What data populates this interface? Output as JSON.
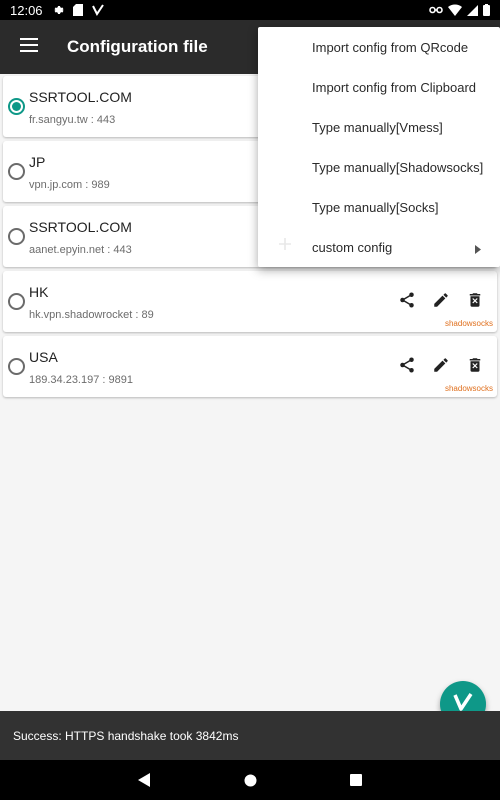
{
  "status_bar": {
    "time": "12:06"
  },
  "app_bar": {
    "title": "Configuration file"
  },
  "servers": [
    {
      "name": "SSRTOOL.COM",
      "address": "fr.sangyu.tw : 443",
      "selected": true
    },
    {
      "name": "JP",
      "address": "vpn.jp.com : 989",
      "selected": false
    },
    {
      "name": "SSRTOOL.COM",
      "address": "aanet.epyin.net : 443",
      "selected": false
    },
    {
      "name": "HK",
      "address": "hk.vpn.shadowrocket : 89",
      "selected": false,
      "type": "shadowsocks"
    },
    {
      "name": "USA",
      "address": "189.34.23.197 : 9891",
      "selected": false,
      "type": "shadowsocks"
    }
  ],
  "popup_menu": [
    "Import config from QRcode",
    "Import config from Clipboard",
    "Type manually[Vmess]",
    "Type manually[Shadowsocks]",
    "Type manually[Socks]",
    "custom config"
  ],
  "snackbar": {
    "message": "Success: HTTPS handshake took 3842ms"
  },
  "colors": {
    "accent": "#0e9888",
    "app_bar": "#2b2b2b",
    "type_label": "#e0701e",
    "snackbar": "#323232"
  },
  "icons": [
    "settings-icon",
    "sd-card-icon",
    "vpn-logo-icon",
    "key-icon",
    "wifi-icon",
    "signal-icon",
    "battery-icon",
    "menu-icon",
    "share-icon",
    "edit-icon",
    "delete-icon",
    "plus-icon",
    "chevron-right-icon",
    "back-icon",
    "home-icon",
    "recents-icon"
  ]
}
